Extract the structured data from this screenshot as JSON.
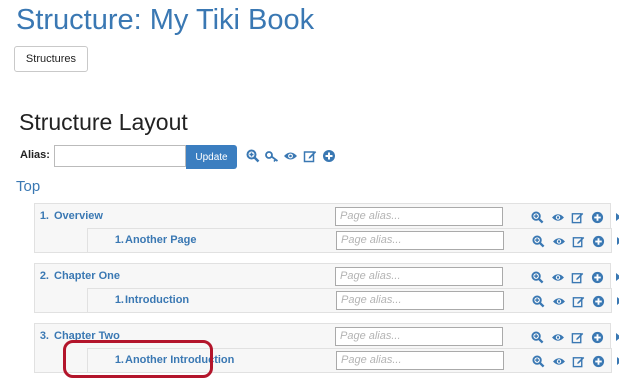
{
  "page": {
    "title": "Structure: My Tiki Book",
    "structures_button": "Structures",
    "layout_title": "Structure Layout",
    "alias_label": "Alias:",
    "update_button": "Update",
    "top_link": "Top",
    "alias_placeholder": "Page alias..."
  },
  "tree": [
    {
      "num": "1.",
      "label": "Overview",
      "children": [
        {
          "num": "1.",
          "label": "Another Page"
        }
      ]
    },
    {
      "num": "2.",
      "label": "Chapter One",
      "children": [
        {
          "num": "1.",
          "label": "Introduction"
        }
      ]
    },
    {
      "num": "3.",
      "label": "Chapter Two",
      "children": [
        {
          "num": "1.",
          "label": "Another Introduction"
        }
      ]
    }
  ],
  "icons": {
    "top": [
      "zoom-in-icon",
      "key-icon",
      "eye-icon",
      "edit-icon",
      "add-icon"
    ],
    "row": [
      "zoom-in-icon",
      "eye-icon",
      "edit-icon",
      "add-icon",
      "move-right-icon",
      "delete-icon"
    ]
  },
  "colors": {
    "link": "#3a78b3",
    "accent": "#3b7ec0",
    "delete": "#1f5fa8",
    "highlight": "#b3152b"
  }
}
